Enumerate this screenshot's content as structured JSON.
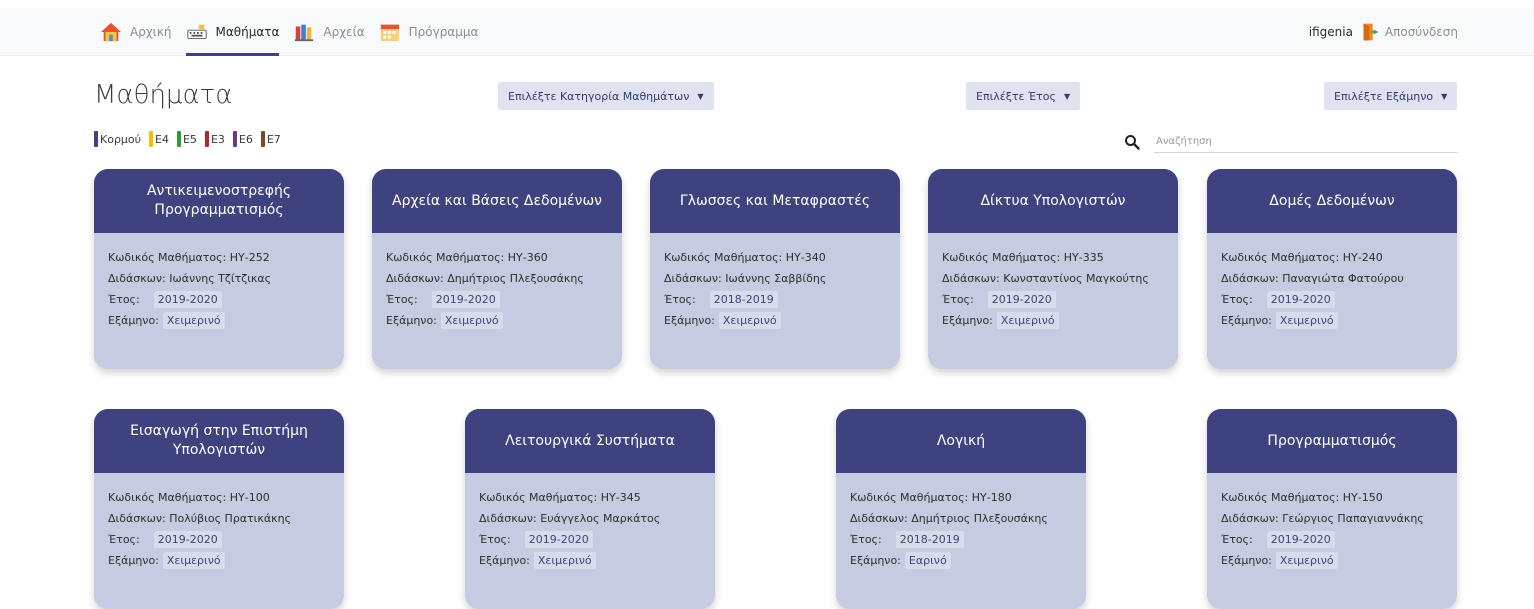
{
  "nav": {
    "items": [
      {
        "label": "Αρχική",
        "icon": "house-icon",
        "active": false
      },
      {
        "label": "Μαθήματα",
        "icon": "keyboard-icon",
        "active": true
      },
      {
        "label": "Αρχεία",
        "icon": "books-icon",
        "active": false
      },
      {
        "label": "Πρόγραμμα",
        "icon": "calendar-icon",
        "active": false
      }
    ],
    "user": "ifigenia",
    "logout_label": "Αποσύνδεση"
  },
  "page": {
    "title": "Μαθήματα"
  },
  "filters": {
    "category": "Επιλέξτε Κατηγορία Μαθημάτων",
    "year": "Επιλέξτε Έτος",
    "semester": "Επιλέξτε Εξάμηνο"
  },
  "legend": [
    {
      "label": "Κορμού",
      "color": "#3e4380"
    },
    {
      "label": "Ε4",
      "color": "#f2c200"
    },
    {
      "label": "Ε5",
      "color": "#2e9b3a"
    },
    {
      "label": "Ε3",
      "color": "#b8262d"
    },
    {
      "label": "Ε6",
      "color": "#6d3b86"
    },
    {
      "label": "Ε7",
      "color": "#7a4a2a"
    }
  ],
  "search": {
    "placeholder": "Αναζήτηση"
  },
  "labels": {
    "code": "Κωδικός Μαθήματος:",
    "instructor": "Διδάσκων:",
    "year": "Έτος:",
    "semester": "Εξάμηνο:"
  },
  "courses": [
    {
      "title": "Αντικειμενοστρεφής Προγραμματισμός",
      "code": "ΗΥ-252",
      "instructor": "Ιωάννης Τζίτζικας",
      "year": "2019-2020",
      "semester": "Χειμερινό"
    },
    {
      "title": "Αρχεία και Βάσεις Δεδομένων",
      "code": "ΗΥ-360",
      "instructor": "Δημήτριος Πλεξουσάκης",
      "year": "2019-2020",
      "semester": "Χειμερινό"
    },
    {
      "title": "Γλωσσες και Μεταφραστές",
      "code": "ΗΥ-340",
      "instructor": "Ιωάννης Σαββίδης",
      "year": "2018-2019",
      "semester": "Χειμερινό"
    },
    {
      "title": "Δίκτυα Υπολογιστών",
      "code": "ΗΥ-335",
      "instructor": "Κωνσταντίνος Μαγκούτης",
      "year": "2019-2020",
      "semester": "Χειμερινό"
    },
    {
      "title": "Δομές Δεδομένων",
      "code": "ΗΥ-240",
      "instructor": "Παναγιώτα Φατούρου",
      "year": "2019-2020",
      "semester": "Χειμερινό"
    },
    {
      "title": "Εισαγωγή στην Επιστήμη Υπολογιστών",
      "code": "ΗΥ-100",
      "instructor": "Πολύβιος Πρατικάκης",
      "year": "2019-2020",
      "semester": "Χειμερινό"
    },
    {
      "title": "Λειτουργικά Συστήματα",
      "code": "ΗΥ-345",
      "instructor": "Ευάγγελος Μαρκάτος",
      "year": "2019-2020",
      "semester": "Χειμερινό"
    },
    {
      "title": "Λογική",
      "code": "ΗΥ-180",
      "instructor": "Δημήτριος Πλεξουσάκης",
      "year": "2018-2019",
      "semester": "Εαρινό"
    },
    {
      "title": "Προγραμματισμός",
      "code": "ΗΥ-150",
      "instructor": "Γεώργιος Παπαγιαννάκης",
      "year": "2019-2020",
      "semester": "Χειμερινό"
    }
  ]
}
